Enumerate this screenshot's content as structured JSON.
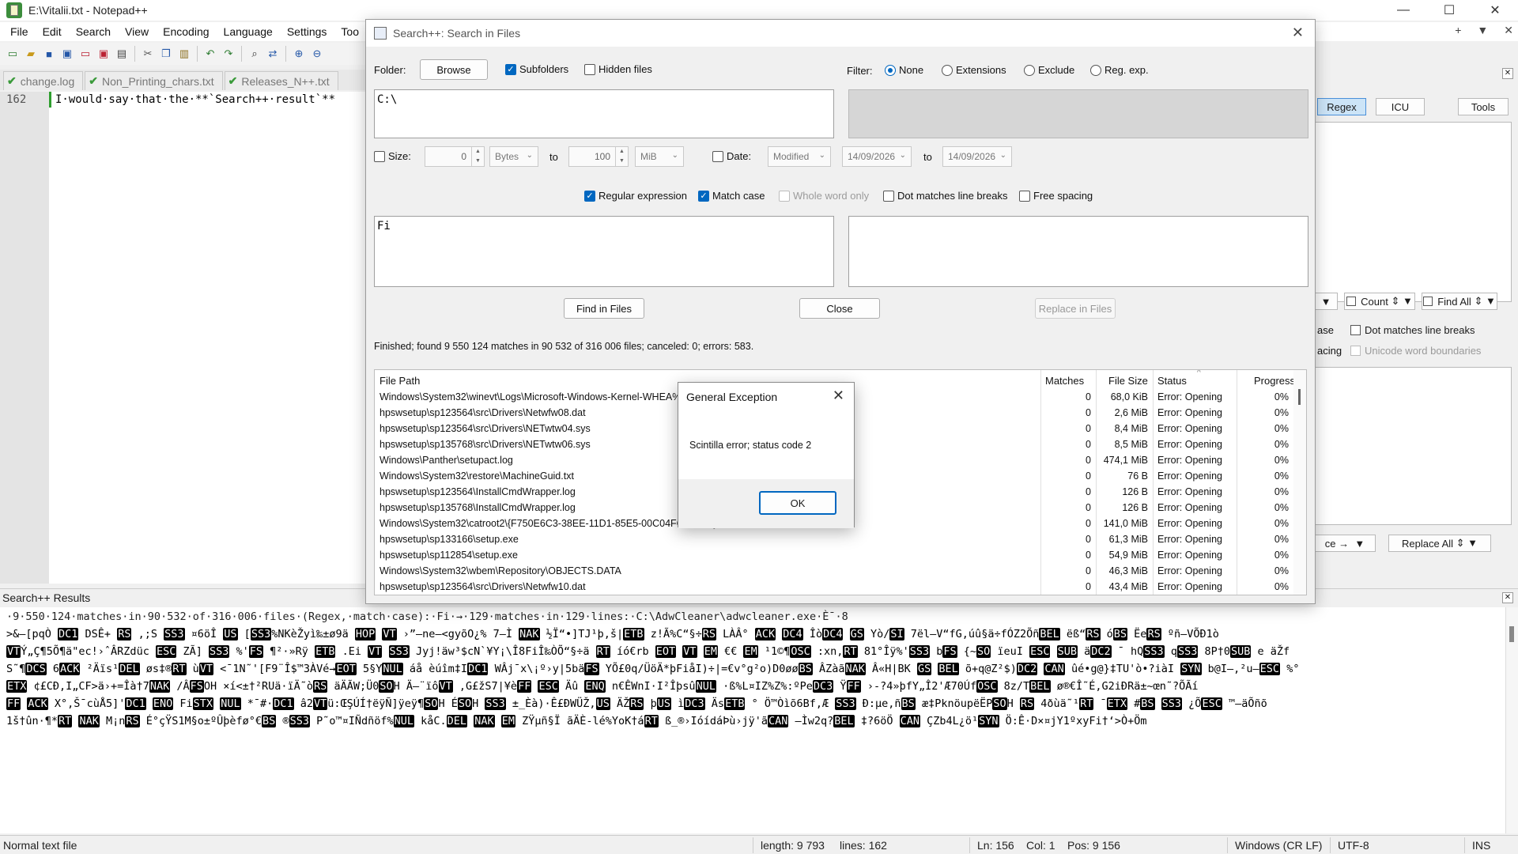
{
  "window": {
    "title": "E:\\Vitalii.txt - Notepad++",
    "controls": [
      "—",
      "☐",
      "✕"
    ]
  },
  "menu": {
    "items": [
      "File",
      "Edit",
      "Search",
      "View",
      "Encoding",
      "Language",
      "Settings",
      "Too"
    ],
    "right": [
      "+",
      "▼",
      "✕"
    ]
  },
  "toolbar": {
    "icons": [
      "new-file-icon",
      "open-file-icon",
      "save-icon",
      "save-all-icon",
      "close-icon",
      "close-all-icon",
      "print-icon",
      "cut-icon",
      "copy-icon",
      "paste-icon",
      "undo-icon",
      "redo-icon",
      "find-icon",
      "replace-icon",
      "zoom-in-icon",
      "zoom-out-icon"
    ]
  },
  "tabs": [
    {
      "label": "change.log"
    },
    {
      "label": "Non_Printing_chars.txt"
    },
    {
      "label": "Releases_N++.txt"
    }
  ],
  "editor": {
    "line_number": "162",
    "text": "I·would·say·that·the·**`Search++·result`**"
  },
  "right_panel": {
    "regex": "Regex",
    "icu": "ICU",
    "tools": "Tools",
    "count": "Count",
    "find_all": "Find All",
    "dot_matches": "Dot matches line breaks",
    "unicode_boundaries": "Unicode word boundaries",
    "frag_ase": "ase",
    "frag_acing": "acing",
    "replace_fragment": "ce →",
    "replace_all": "Replace All"
  },
  "dialog": {
    "title": "Search++: Search in Files",
    "folder_label": "Folder:",
    "browse": "Browse",
    "subfolders": "Subfolders",
    "hidden_files": "Hidden files",
    "filter_label": "Filter:",
    "filter_options": [
      "None",
      "Extensions",
      "Exclude",
      "Reg. exp."
    ],
    "folder_value": "C:\\",
    "size_label": "Size:",
    "size_min": "0",
    "size_unit_min": "Bytes",
    "to": "to",
    "size_max": "100",
    "size_unit_max": "MiB",
    "date_label": "Date:",
    "date_type": "Modified",
    "date_from": "14/09/2026",
    "date_to": "14/09/2026",
    "regular_expression": "Regular expression",
    "match_case": "Match case",
    "whole_word": "Whole word only",
    "dot_matches": "Dot matches line breaks",
    "free_spacing": "Free spacing",
    "find_value": "Fi",
    "find_in_files": "Find in Files",
    "close": "Close",
    "replace_in_files": "Replace in Files",
    "status": "Finished; found 9 550 124 matches in 90 532 of 316 006 files; canceled: 0; errors: 583."
  },
  "table": {
    "headers": [
      "File Path",
      "Matches",
      "File Size",
      "Status",
      "Progress"
    ],
    "rows": [
      {
        "path": "Windows\\System32\\winevt\\Logs\\Microsoft-Windows-Kernel-WHEA%4Errors.evtx",
        "matches": "0",
        "size": "68,0 KiB",
        "status": "Error: Opening",
        "progress": "0%"
      },
      {
        "path": "hpswsetup\\sp123564\\src\\Drivers\\Netwfw08.dat",
        "matches": "0",
        "size": "2,6 MiB",
        "status": "Error: Opening",
        "progress": "0%"
      },
      {
        "path": "hpswsetup\\sp123564\\src\\Drivers\\NETwtw04.sys",
        "matches": "0",
        "size": "8,4 MiB",
        "status": "Error: Opening",
        "progress": "0%"
      },
      {
        "path": "hpswsetup\\sp135768\\src\\Drivers\\NETwtw06.sys",
        "matches": "0",
        "size": "8,5 MiB",
        "status": "Error: Opening",
        "progress": "0%"
      },
      {
        "path": "Windows\\Panther\\setupact.log",
        "matches": "0",
        "size": "474,1 MiB",
        "status": "Error: Opening",
        "progress": "0%"
      },
      {
        "path": "Windows\\System32\\restore\\MachineGuid.txt",
        "matches": "0",
        "size": "76 B",
        "status": "Error: Opening",
        "progress": "0%"
      },
      {
        "path": "hpswsetup\\sp123564\\InstallCmdWrapper.log",
        "matches": "0",
        "size": "126 B",
        "status": "Error: Opening",
        "progress": "0%"
      },
      {
        "path": "hpswsetup\\sp135768\\InstallCmdWrapper.log",
        "matches": "0",
        "size": "126 B",
        "status": "Error: Opening",
        "progress": "0%"
      },
      {
        "path": "Windows\\System32\\catroot2\\{F750E6C3-38EE-11D1-85E5-00C04FC295EE}\\catdb",
        "matches": "0",
        "size": "141,0 MiB",
        "status": "Error: Opening",
        "progress": "0%"
      },
      {
        "path": "hpswsetup\\sp133166\\setup.exe",
        "matches": "0",
        "size": "61,3 MiB",
        "status": "Error: Opening",
        "progress": "0%"
      },
      {
        "path": "hpswsetup\\sp112854\\setup.exe",
        "matches": "0",
        "size": "54,9 MiB",
        "status": "Error: Opening",
        "progress": "0%"
      },
      {
        "path": "Windows\\System32\\wbem\\Repository\\OBJECTS.DATA",
        "matches": "0",
        "size": "46,3 MiB",
        "status": "Error: Opening",
        "progress": "0%"
      },
      {
        "path": "hpswsetup\\sp123564\\src\\Drivers\\Netwfw10.dat",
        "matches": "0",
        "size": "43,4 MiB",
        "status": "Error: Opening",
        "progress": "0%"
      }
    ]
  },
  "modal": {
    "title": "General Exception",
    "message": "Scintilla error; status code 2",
    "ok": "OK"
  },
  "results_panel": {
    "title": "Search++ Results",
    "summary": "·9·550·124·matches·in·90·532·of·316·006·files·(Regex,·match·case):·Fi·→·129·matches·in·129·lines:·C:\\AdwCleaner\\adwcleaner.exe·È¯·8",
    "lines": [
      ">&—[pqÒ DC1 DSÊ+ RS ,;S SS3 ¤6öÎ US [SS3%NKèŽyì‰±ø9ä HOP VT ›”–ne–<gyõO¿% 7–Ì NAK ½Ï“•]TJ¹þ,š|ETB z!Ã%C“§÷RS LÀÂ° ACK DC4 ÎòDC4 GS Yò/SI 7ël–V“fG,úû§ä÷fÓZ2ÕñBEL ëß“RS óBS ËeRS ºñ–VÕÐ1ò",
      "VTÝ„Ç¶5Õ¶ä\"ec!›ˆÂRZdüc ESC ZÃ] SS3 %'FS ¶²·»Rÿ ETB .Ei VT SS3 Jyj!äw³$cN`¥Y¡\\Î8FiÎ‰ÒÕ“§÷ä RT íó€rb EOT VT EM €€ EM ¹1©¶OSC :xn,RT 81°Îÿ%'SS3 bFS {~SO ïeuI ESC SUB äDC2 ¯ hQSS3 qSS3 8P†0SUB e äŽf",
      "S˜¶DCS 6ACK ²Äïs¹DEL øs‡®RT ùVT <¯1N˜'[F9¨Î$™3ÀVé→EOT 5§YNUL áå èúîm‡IDC1 WÂj¯x\\¡º›y|5bäFS YÕ£0q/ÜöÄ*þFiåI)÷|=€v°g²o)D0øøBS ÂZàãNAK Â«H|BK GS BEL õ+q@Z²$)DC2 CAN ûé•g@}‡TU'ò•?iàI SYN b@I–,²u–ESC %°",
      "ETX ¢£CÐ,I„CF>ä›+=Îà†7NAK /ÂFSOH ×í<±†²RUä·ïÄ˜òRS äÄÃW;Ü0SOH Ä–¨ïôVT ,G£žS7|¥èFF ESC Äû ENQ n€ÊWnI·I²ÎþsûNUL ·ß%L¤IZ%Z%:ºPeDC3 ŸFF ›-?4»þfY„Î2'Æ70ÚfOSC 8z/TBEL ø®€Î˜É,G2iÐRä±~œn˜?ÕÃí",
      "FF ACK X°,Š¯cùÅ5]'DC1 ENO FiSTX NUL *¯#·DC1 â2VTü:ŒŞÚÍ†ëÿÑ]ÿeÿ¶SOH ÉSOH SS3 ±_Èà)·Ê£ÐWÜŽ,US ÄŽRS þUS ìDC3 ÄsETB ° Ö™Òìõ6Bf,Æ SS3 Ð:µe,ñBS æ‡PknöupëËPSOH RS 4ðùä˜¹RT ¯ETX #BS SS3 ¿ÕESC ™–äÕñõ",
      "1š†ûn·¶*RT NAK M¡nRS É°çŸS1M§o±ºÛþèfø°€BS ®SS3 P˜o™¤IÑdñöf%NUL kåC.DEL NAK EM ZŸµñ§Ï ãÄÈ-lé%YoK†áRT ß_®›IóídáÞù›jÿ'ãCAN –Ìw2q?BEL ‡?6öÖ CAN ÇZb4L¿ö¹SYN Ö:Ê·D×¤jY1ºxyFi†‘>Ò+Öm"
    ]
  },
  "statusbar": {
    "file_type": "Normal text file",
    "length": "length: 9 793",
    "lines": "lines: 162",
    "ln": "Ln: 156",
    "col": "Col: 1",
    "pos": "Pos: 9 156",
    "eol": "Windows (CR LF)",
    "encoding": "UTF-8",
    "mode": "INS"
  }
}
